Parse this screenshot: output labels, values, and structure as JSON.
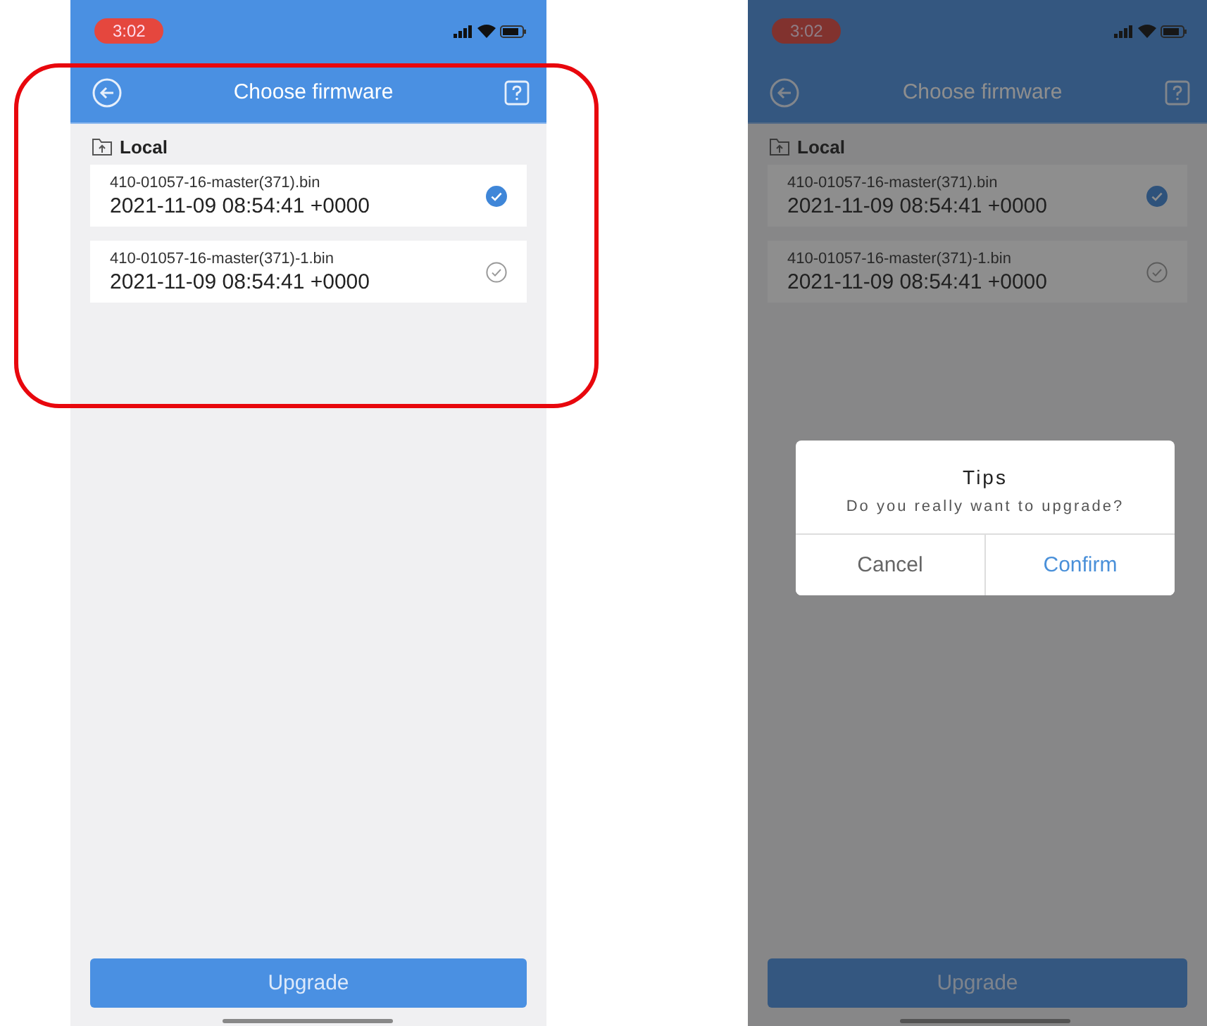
{
  "screens": [
    {
      "status_time": "3:02",
      "title": "Choose firmware",
      "section": "Local",
      "highlighted": true,
      "dimmed": false,
      "files": [
        {
          "name": "410-01057-16-master(371).bin",
          "date": "2021-11-09 08:54:41 +0000",
          "selected": true
        },
        {
          "name": "410-01057-16-master(371)-1.bin",
          "date": "2021-11-09 08:54:41 +0000",
          "selected": false
        }
      ],
      "primary_button": "Upgrade"
    },
    {
      "status_time": "3:02",
      "title": "Choose firmware",
      "section": "Local",
      "highlighted": false,
      "dimmed": true,
      "files": [
        {
          "name": "410-01057-16-master(371).bin",
          "date": "2021-11-09 08:54:41 +0000",
          "selected": true
        },
        {
          "name": "410-01057-16-master(371)-1.bin",
          "date": "2021-11-09 08:54:41 +0000",
          "selected": false
        }
      ],
      "primary_button": "Upgrade",
      "dialog": {
        "title": "Tips",
        "message": "Do you really want to upgrade?",
        "buttons": [
          {
            "label": "Cancel",
            "kind": "cancel"
          },
          {
            "label": "Confirm",
            "kind": "confirm"
          }
        ]
      }
    }
  ]
}
